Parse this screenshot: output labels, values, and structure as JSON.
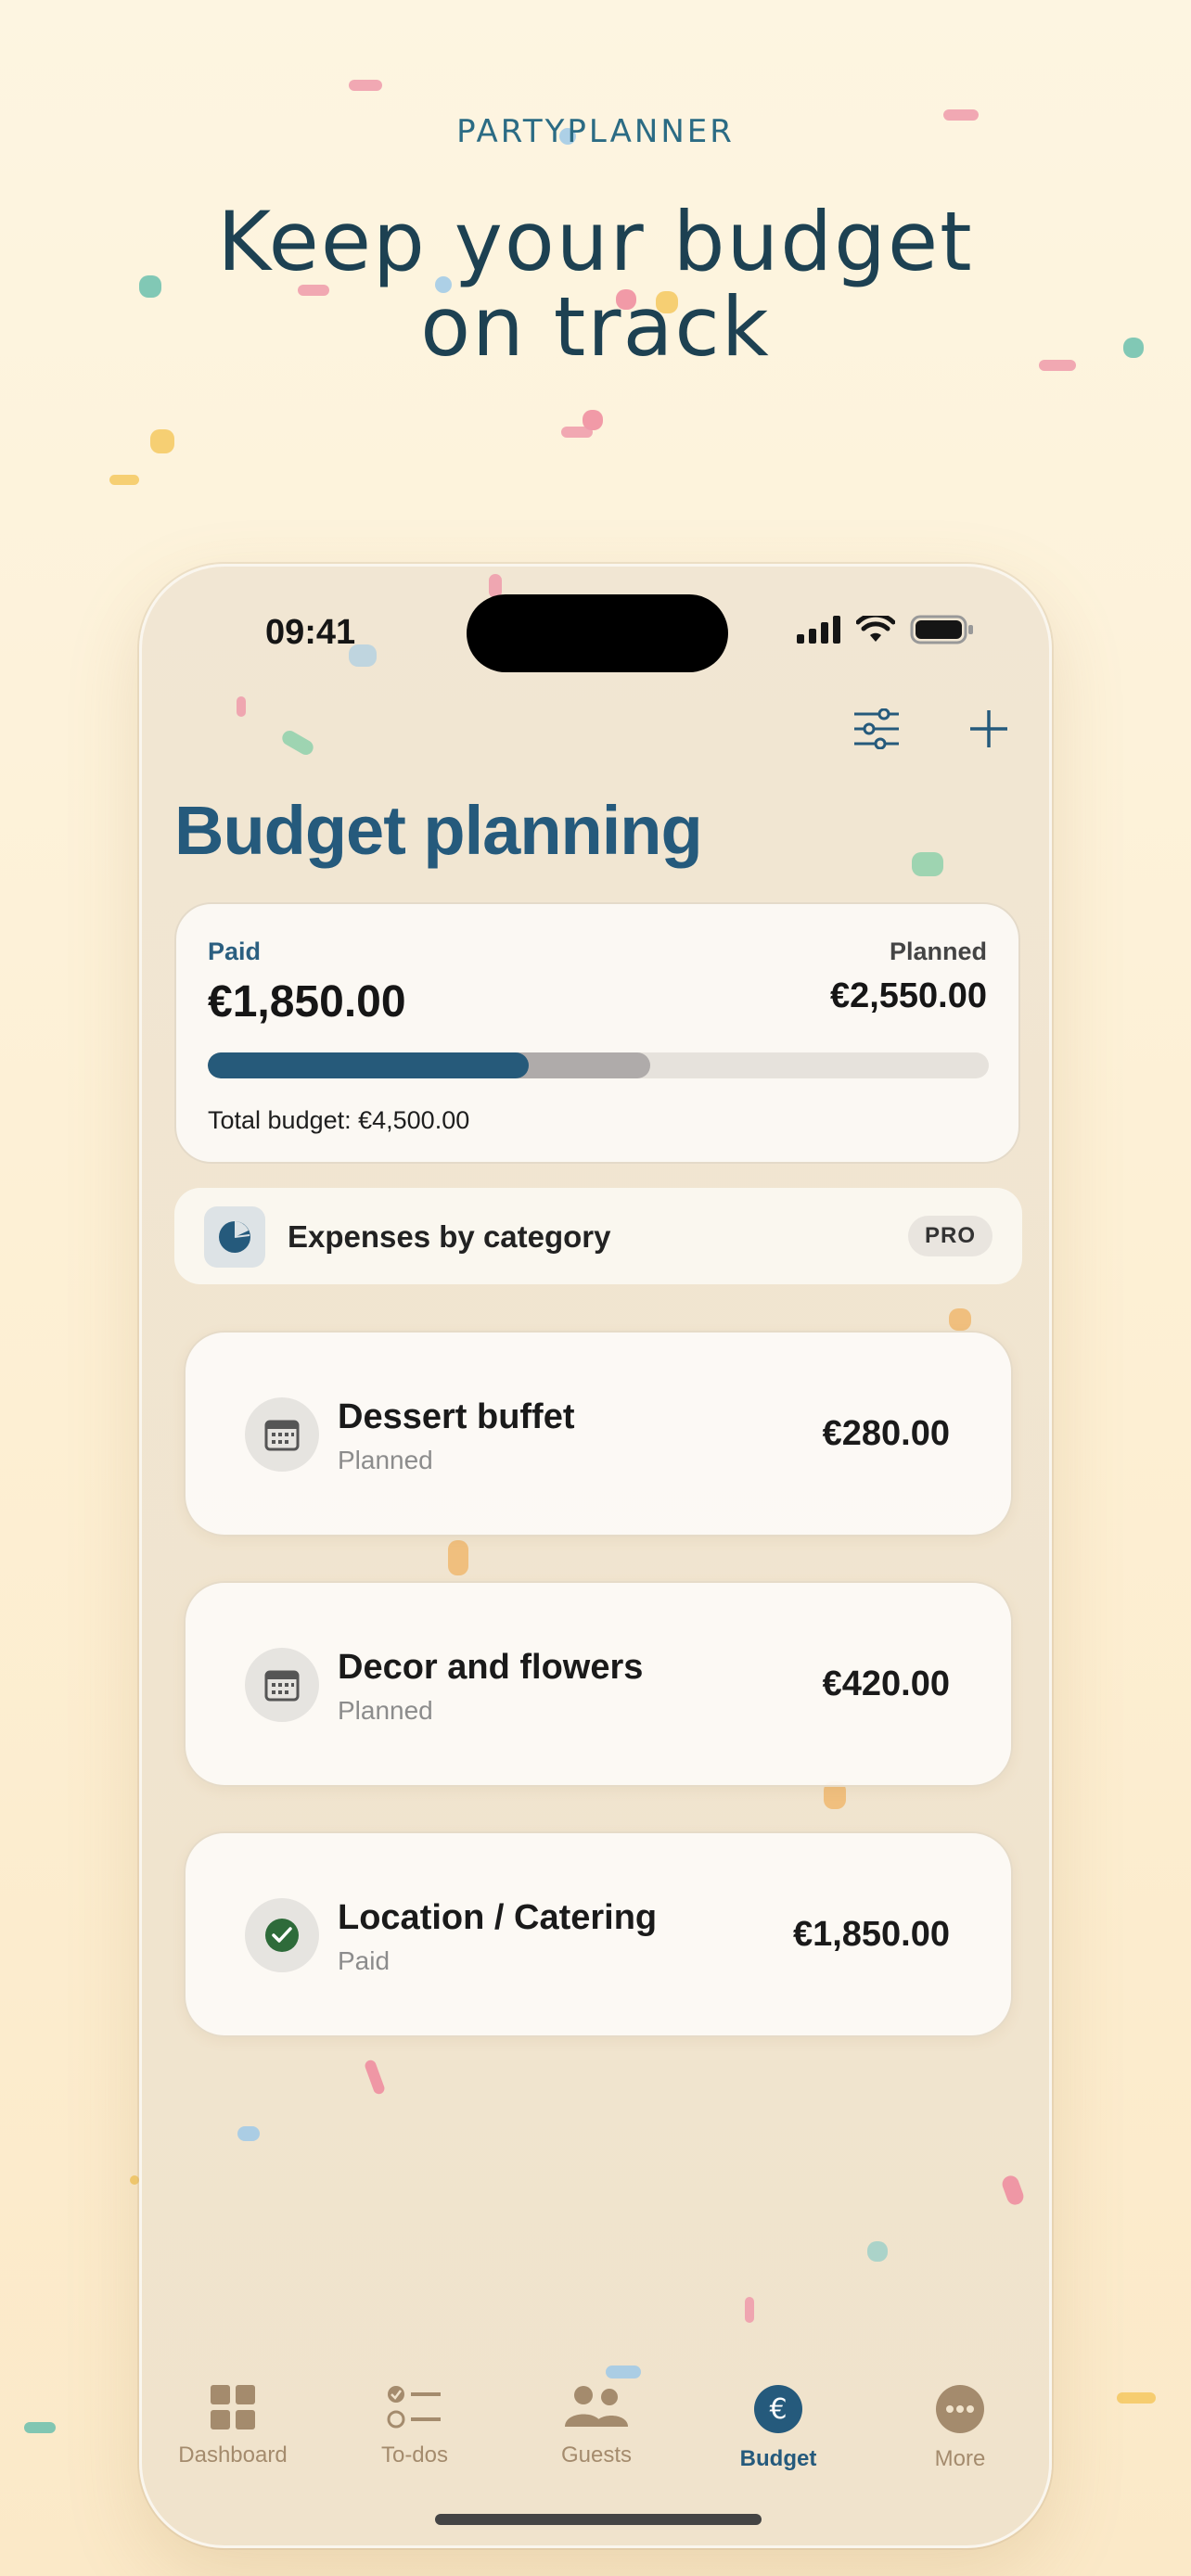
{
  "brand": "PARTYPLANNER",
  "headline": {
    "line1": "Keep your budget",
    "line2": "on track"
  },
  "status_bar": {
    "time": "09:41"
  },
  "toolbar": {
    "filter_icon": "sliders-icon",
    "add_icon": "plus-icon"
  },
  "page_title": "Budget planning",
  "summary": {
    "paid_label": "Paid",
    "paid_value": "€1,850.00",
    "planned_label": "Planned",
    "planned_value": "€2,550.00",
    "total": "Total budget: €4,500.00",
    "progress": {
      "paid_fraction": 0.4111,
      "planned_fraction": 0.5667
    }
  },
  "category_row": {
    "label": "Expenses by category",
    "badge": "PRO",
    "icon": "pie-chart-icon"
  },
  "expenses": [
    {
      "title": "Dessert buffet",
      "status": "Planned",
      "amount": "€280.00",
      "icon": "calendar-icon"
    },
    {
      "title": "Decor and flowers",
      "status": "Planned",
      "amount": "€420.00",
      "icon": "calendar-icon"
    },
    {
      "title": "Location / Catering",
      "status": "Paid",
      "amount": "€1,850.00",
      "icon": "check-circle-icon"
    }
  ],
  "tabs": [
    {
      "label": "Dashboard",
      "icon": "grid-icon"
    },
    {
      "label": "To-dos",
      "icon": "checklist-icon"
    },
    {
      "label": "Guests",
      "icon": "people-icon"
    },
    {
      "label": "Budget",
      "icon": "euro-icon",
      "active": true
    },
    {
      "label": "More",
      "icon": "more-icon"
    }
  ],
  "colors": {
    "accent": "#255a7c",
    "background": "#fdf2da",
    "tab_inactive": "#a48b6d",
    "paid_check": "#2e6b3a"
  }
}
